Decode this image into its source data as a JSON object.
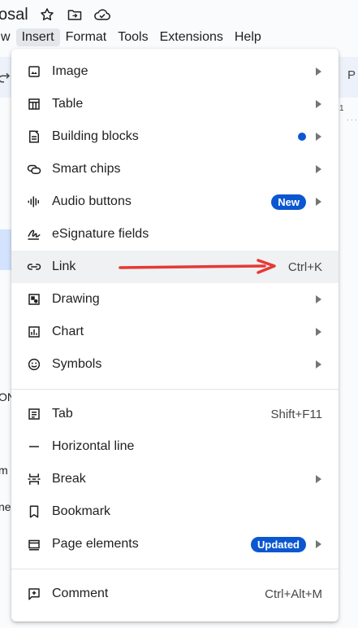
{
  "header": {
    "title_fragment": "osal",
    "title_icons": [
      "star-icon",
      "move-to-folder-icon",
      "cloud-saved-icon"
    ]
  },
  "menubar": {
    "items": [
      {
        "label": "w"
      },
      {
        "label": "Insert"
      },
      {
        "label": "Format"
      },
      {
        "label": "Tools"
      },
      {
        "label": "Extensions"
      },
      {
        "label": "Help"
      }
    ]
  },
  "background_fragments": {
    "ruler_letter": "P",
    "ruler_number": "1",
    "left_1": "ON",
    "left_2": "m",
    "left_3": "ne"
  },
  "colors": {
    "accent": "#0b57d0",
    "arrow": "#e53935",
    "hover": "#f0f1f2"
  },
  "insert_menu": {
    "group1": [
      {
        "label": "Image",
        "icon": "image-icon",
        "submenu": true
      },
      {
        "label": "Table",
        "icon": "table-icon",
        "submenu": true
      },
      {
        "label": "Building blocks",
        "icon": "building-blocks-icon",
        "submenu": true,
        "dot": true
      },
      {
        "label": "Smart chips",
        "icon": "smart-chips-icon",
        "submenu": true
      },
      {
        "label": "Audio buttons",
        "icon": "audio-icon",
        "submenu": true,
        "badge": "New"
      },
      {
        "label": "eSignature fields",
        "icon": "esignature-icon",
        "submenu": false
      },
      {
        "label": "Link",
        "icon": "link-icon",
        "submenu": false,
        "shortcut": "Ctrl+K",
        "hovered": true
      },
      {
        "label": "Drawing",
        "icon": "drawing-icon",
        "submenu": true
      },
      {
        "label": "Chart",
        "icon": "chart-icon",
        "submenu": true
      },
      {
        "label": "Symbols",
        "icon": "symbols-icon",
        "submenu": true
      }
    ],
    "group2": [
      {
        "label": "Tab",
        "icon": "tab-icon",
        "submenu": false,
        "shortcut": "Shift+F11"
      },
      {
        "label": "Horizontal line",
        "icon": "horizontal-line-icon",
        "submenu": false
      },
      {
        "label": "Break",
        "icon": "break-icon",
        "submenu": true
      },
      {
        "label": "Bookmark",
        "icon": "bookmark-icon",
        "submenu": false
      },
      {
        "label": "Page elements",
        "icon": "page-elements-icon",
        "submenu": true,
        "badge": "Updated"
      }
    ],
    "group3": [
      {
        "label": "Comment",
        "icon": "comment-icon",
        "submenu": false,
        "shortcut": "Ctrl+Alt+M"
      }
    ]
  }
}
